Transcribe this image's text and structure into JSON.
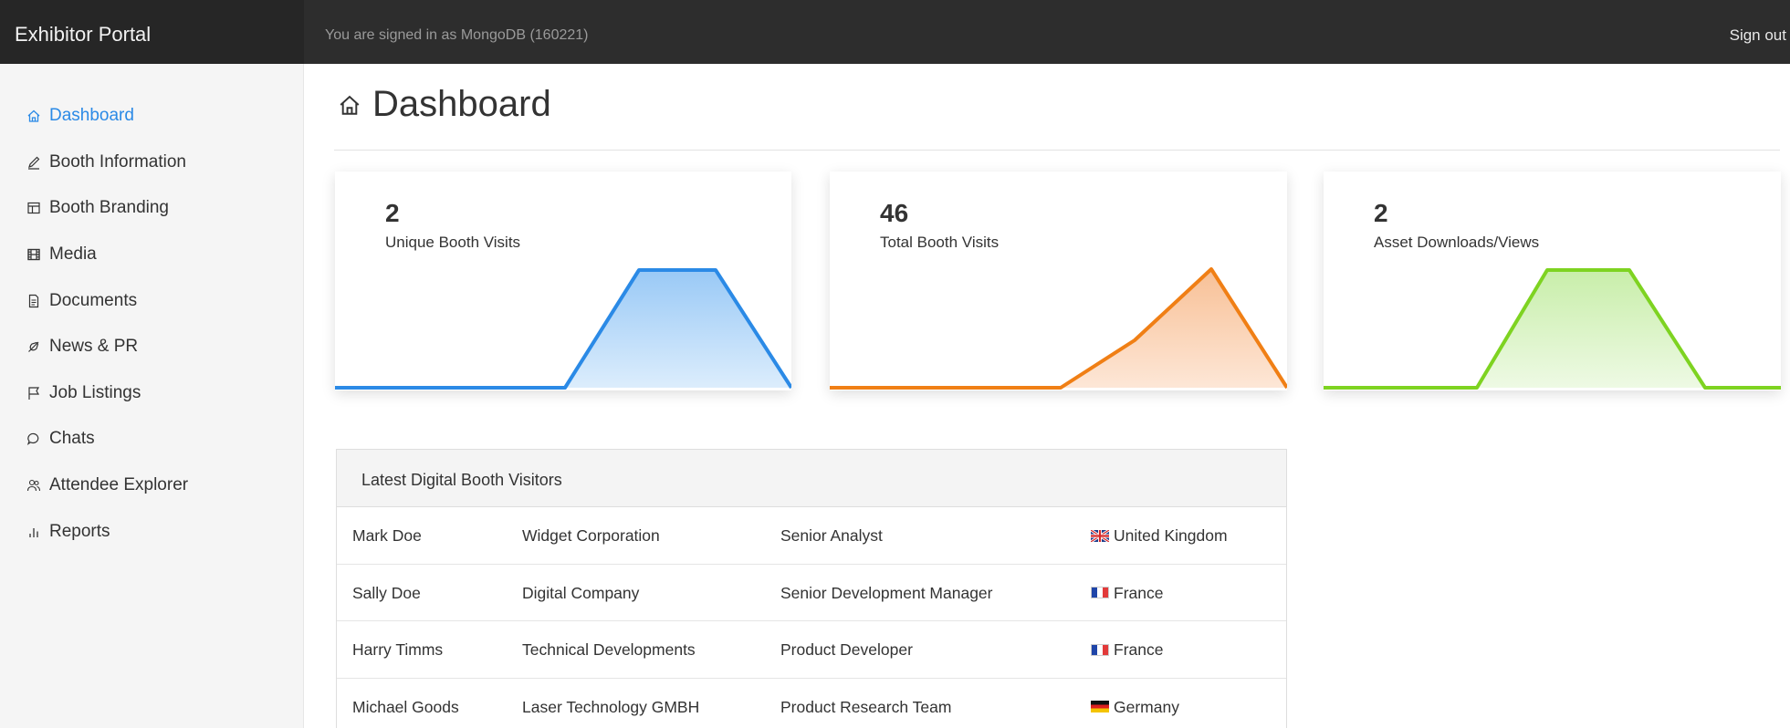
{
  "header": {
    "brand": "Exhibitor Portal",
    "signed_in": "You are signed in as MongoDB (160221)",
    "sign_out": "Sign out"
  },
  "sidebar": {
    "items": [
      {
        "label": "Dashboard",
        "icon": "home-icon",
        "active": true
      },
      {
        "label": "Booth Information",
        "icon": "pencil-icon"
      },
      {
        "label": "Booth Branding",
        "icon": "layout-icon"
      },
      {
        "label": "Media",
        "icon": "film-icon"
      },
      {
        "label": "Documents",
        "icon": "document-icon"
      },
      {
        "label": "News & PR",
        "icon": "megaphone-icon"
      },
      {
        "label": "Job Listings",
        "icon": "flag-icon"
      },
      {
        "label": "Chats",
        "icon": "chat-icon"
      },
      {
        "label": "Attendee Explorer",
        "icon": "users-icon"
      },
      {
        "label": "Reports",
        "icon": "bar-chart-icon"
      }
    ]
  },
  "main": {
    "title": "Dashboard",
    "title_icon": "home-icon"
  },
  "stats": [
    {
      "value": "2",
      "label": "Unique Booth Visits",
      "color": "#2b8ae6"
    },
    {
      "value": "46",
      "label": "Total Booth Visits",
      "color": "#f07f15"
    },
    {
      "value": "2",
      "label": "Asset Downloads/Views",
      "color": "#7ed321"
    }
  ],
  "visitors": {
    "heading": "Latest Digital Booth Visitors",
    "rows": [
      {
        "name": "Mark Doe",
        "company": "Widget Corporation",
        "role": "Senior Analyst",
        "country": "United Kingdom",
        "flag": "uk"
      },
      {
        "name": "Sally Doe",
        "company": "Digital Company",
        "role": "Senior Development Manager",
        "country": "France",
        "flag": "fr"
      },
      {
        "name": "Harry Timms",
        "company": "Technical Developments",
        "role": "Product Developer",
        "country": "France",
        "flag": "fr"
      },
      {
        "name": "Michael Goods",
        "company": "Laser Technology GMBH",
        "role": "Product Research Team",
        "country": "Germany",
        "flag": "de"
      }
    ]
  }
}
